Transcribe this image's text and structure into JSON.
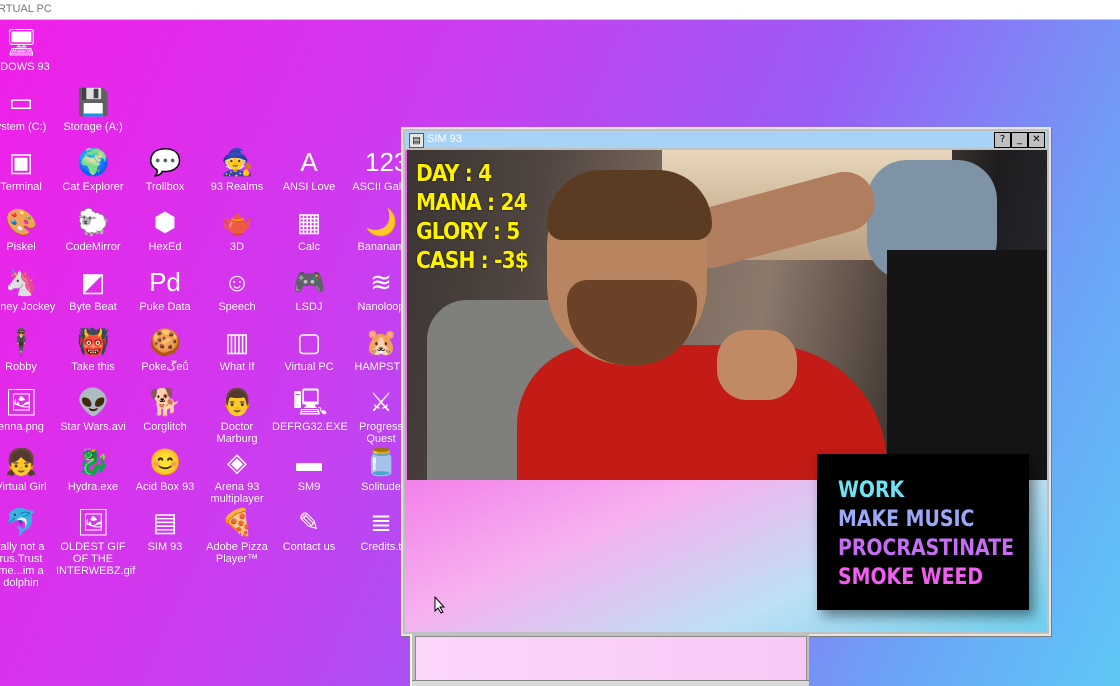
{
  "topbar": {
    "title": "RTUAL PC"
  },
  "desktop": {
    "icons": [
      {
        "label": "NDOWS 93",
        "glyph": "🖥",
        "icon": "computer-icon"
      },
      {
        "label": "ystem (C:)",
        "glyph": "▭",
        "icon": "drive-icon"
      },
      {
        "label": "Storage (A:)",
        "glyph": "💾",
        "icon": "floppy-drive-icon"
      },
      {
        "label": "Terminal",
        "glyph": "▣",
        "icon": "terminal-icon"
      },
      {
        "label": "Cat Explorer",
        "glyph": "🌍",
        "icon": "cat-explorer-icon"
      },
      {
        "label": "Trollbox",
        "glyph": "💬",
        "icon": "trollbox-icon"
      },
      {
        "label": "93 Realms",
        "glyph": "🧙",
        "icon": "realms-icon"
      },
      {
        "label": "ANSI Love",
        "glyph": "A",
        "icon": "ansi-icon"
      },
      {
        "label": "ASCII Galle",
        "glyph": "123",
        "icon": "ascii-icon"
      },
      {
        "label": "Piskel",
        "glyph": "🎨",
        "icon": "palette-icon"
      },
      {
        "label": "CodeMirror",
        "glyph": "🐑",
        "icon": "codemirror-icon"
      },
      {
        "label": "HexEd",
        "glyph": "⬢",
        "icon": "cube-icon"
      },
      {
        "label": "3D",
        "glyph": "🫖",
        "icon": "teapot-icon"
      },
      {
        "label": "Calc",
        "glyph": "▦",
        "icon": "calculator-icon"
      },
      {
        "label": "Bananam",
        "glyph": "🌙",
        "icon": "banana-icon"
      },
      {
        "label": "Poney Jockey",
        "glyph": "🦄",
        "icon": "pony-icon"
      },
      {
        "label": "Byte Beat",
        "glyph": "◩",
        "icon": "bytebeat-icon"
      },
      {
        "label": "Puke Data",
        "glyph": "Pd",
        "icon": "pukedata-icon"
      },
      {
        "label": "Speech",
        "glyph": "☺",
        "icon": "speech-icon"
      },
      {
        "label": "LSDJ",
        "glyph": "🎮",
        "icon": "gameboy-icon"
      },
      {
        "label": "Nanoloop",
        "glyph": "≋",
        "icon": "nanoloop-icon"
      },
      {
        "label": "Robby",
        "glyph": "🕴",
        "icon": "robby-icon"
      },
      {
        "label": "Take this",
        "glyph": "👹",
        "icon": "take-this-icon"
      },
      {
        "label": "Pokeڱeṹ",
        "glyph": "🍪",
        "icon": "poke-icon"
      },
      {
        "label": "What If",
        "glyph": "▥",
        "icon": "what-if-icon"
      },
      {
        "label": "Virtual PC",
        "glyph": "▢",
        "icon": "virtual-pc-icon"
      },
      {
        "label": "HAMPSTE",
        "glyph": "🐹",
        "icon": "hamster-icon"
      },
      {
        "label": "enna.png",
        "glyph": "🖼",
        "icon": "image-file-icon"
      },
      {
        "label": "Star Wars.avi",
        "glyph": "👽",
        "icon": "yoda-icon"
      },
      {
        "label": "Corglitch",
        "glyph": "🐕",
        "icon": "corgi-icon"
      },
      {
        "label": "Doctor Marburg",
        "glyph": "👨",
        "icon": "doctor-icon"
      },
      {
        "label": "DEFRG32.EXE",
        "glyph": "🖳",
        "icon": "defrag-icon"
      },
      {
        "label": "Progress Quest",
        "glyph": "⚔",
        "icon": "progress-quest-icon"
      },
      {
        "label": "Virtual Girl",
        "glyph": "👧",
        "icon": "virtual-girl-icon"
      },
      {
        "label": "Hydra.exe",
        "glyph": "🐉",
        "icon": "hydra-icon"
      },
      {
        "label": "Acid Box 93",
        "glyph": "😊",
        "icon": "smiley-icon"
      },
      {
        "label": "Arena 93 multiplayer",
        "glyph": "◈",
        "icon": "arena-icon"
      },
      {
        "label": "SM9",
        "glyph": "▬",
        "icon": "sm9-icon"
      },
      {
        "label": "Solitude",
        "glyph": "🫙",
        "icon": "solitude-icon"
      },
      {
        "label": "tally not a rus.Trust me...im a dolphin",
        "glyph": "🐬",
        "icon": "dolphin-icon"
      },
      {
        "label": "OLDEST GIF OF THE INTERWEBZ.gif",
        "glyph": "🖼",
        "icon": "gif-file-icon"
      },
      {
        "label": "SIM 93",
        "glyph": "▤",
        "icon": "sim93-icon"
      },
      {
        "label": "Adobe Pizza Player™",
        "glyph": "🍕",
        "icon": "pizza-icon"
      },
      {
        "label": "Contact us",
        "glyph": "✎",
        "icon": "contact-icon"
      },
      {
        "label": "Credits.t",
        "glyph": "≣",
        "icon": "credits-icon"
      }
    ]
  },
  "window": {
    "title": "SIM 93",
    "help": "?",
    "minimize": "_",
    "close": "✕",
    "stats": [
      "DAY : 4",
      "MANA : 24",
      "GLORY : 5",
      "CASH : -3$"
    ],
    "menu": [
      {
        "label": "WORK",
        "color": "#6fe3f5"
      },
      {
        "label": "MAKE MUSIC",
        "color": "#9ca8f7"
      },
      {
        "label": "PROCRASTINATE",
        "color": "#c76cf5"
      },
      {
        "label": "SMOKE WEED",
        "color": "#f25ef0"
      }
    ]
  }
}
